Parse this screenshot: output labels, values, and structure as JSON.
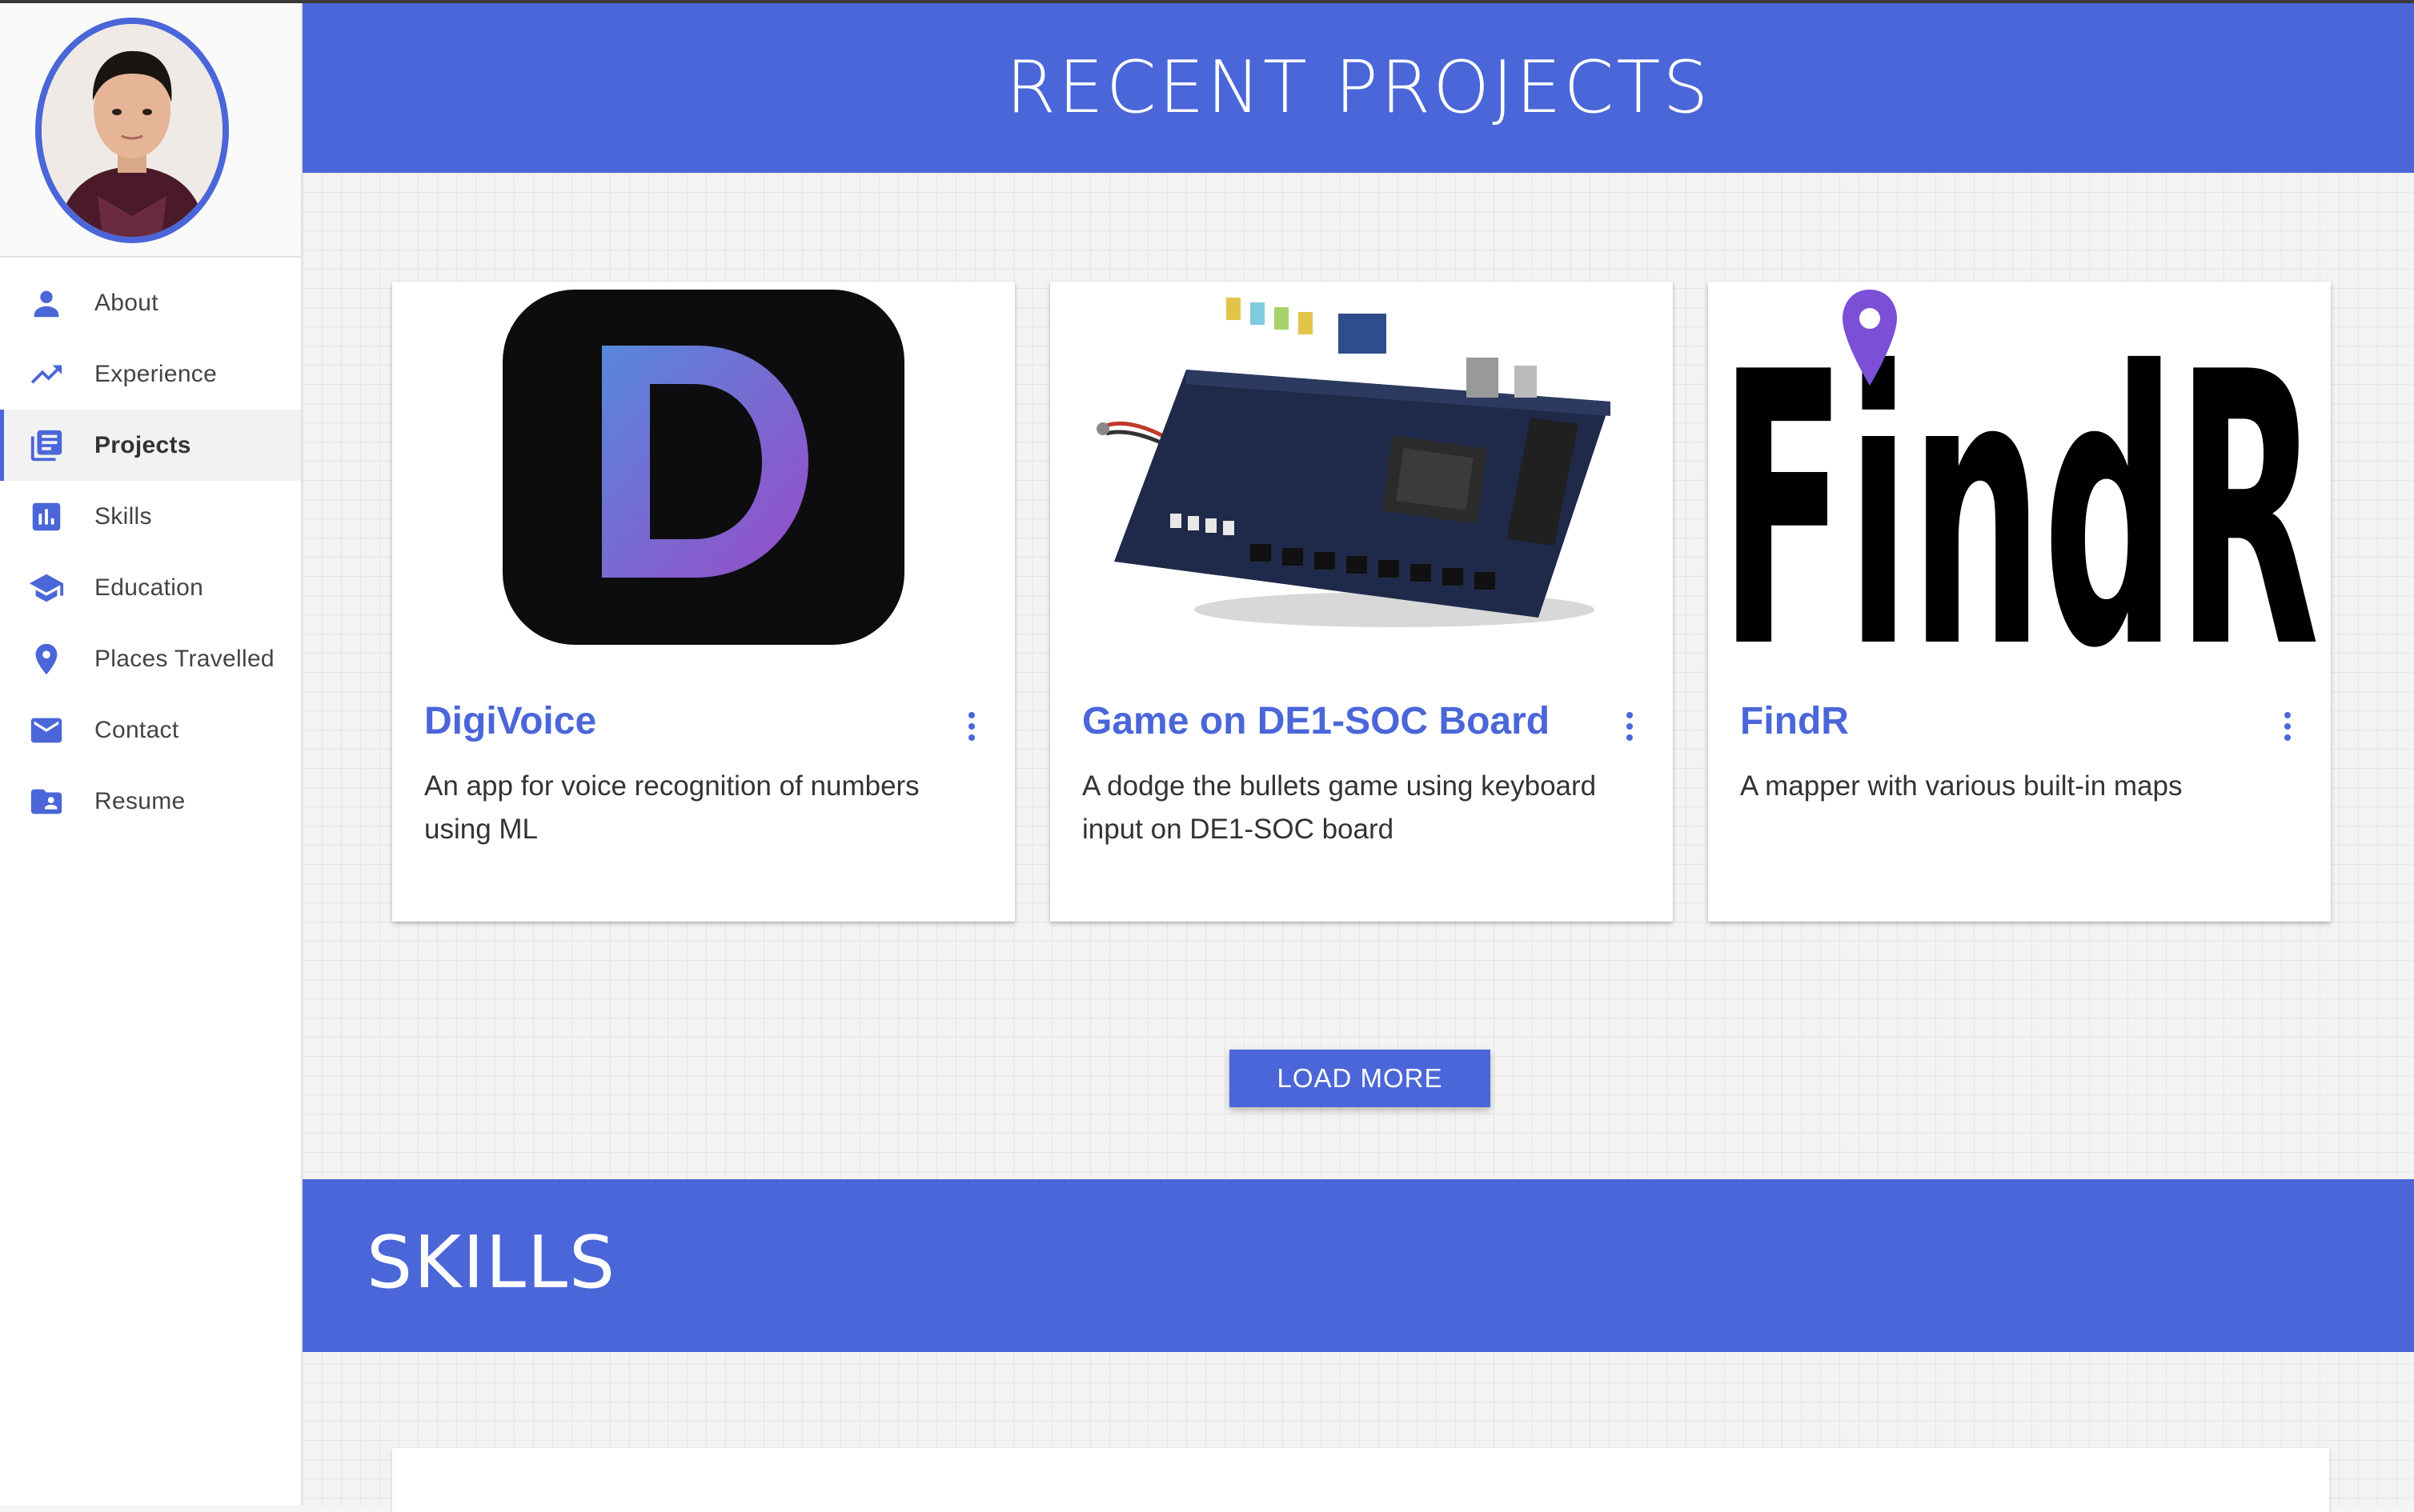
{
  "sidebar": {
    "items": [
      {
        "label": "About",
        "icon": "person-icon"
      },
      {
        "label": "Experience",
        "icon": "trending-up-icon"
      },
      {
        "label": "Projects",
        "icon": "list-icon"
      },
      {
        "label": "Skills",
        "icon": "bar-chart-icon"
      },
      {
        "label": "Education",
        "icon": "graduation-cap-icon"
      },
      {
        "label": "Places Travelled",
        "icon": "location-pin-icon"
      },
      {
        "label": "Contact",
        "icon": "mail-icon"
      },
      {
        "label": "Resume",
        "icon": "folder-person-icon"
      }
    ],
    "active": "Projects"
  },
  "projects": {
    "heading": "RECENT PROJECTS",
    "cards": [
      {
        "title": "DigiVoice",
        "description": "An app for voice recognition of numbers using ML"
      },
      {
        "title": "Game on DE1-SOC Board",
        "description": "A dodge the bullets game using keyboard input on DE1-SOC board"
      },
      {
        "title": "FindR",
        "description": "A mapper with various built-in maps",
        "logo_text": "FindR"
      }
    ],
    "load_more_label": "LOAD MORE"
  },
  "skills": {
    "heading": "SKILLS"
  },
  "colors": {
    "accent": "#4a66d8",
    "digivoice_gradient_start": "#5b8ee6",
    "digivoice_gradient_end": "#a04fd0",
    "findr_pin": "#7b4fd6"
  }
}
